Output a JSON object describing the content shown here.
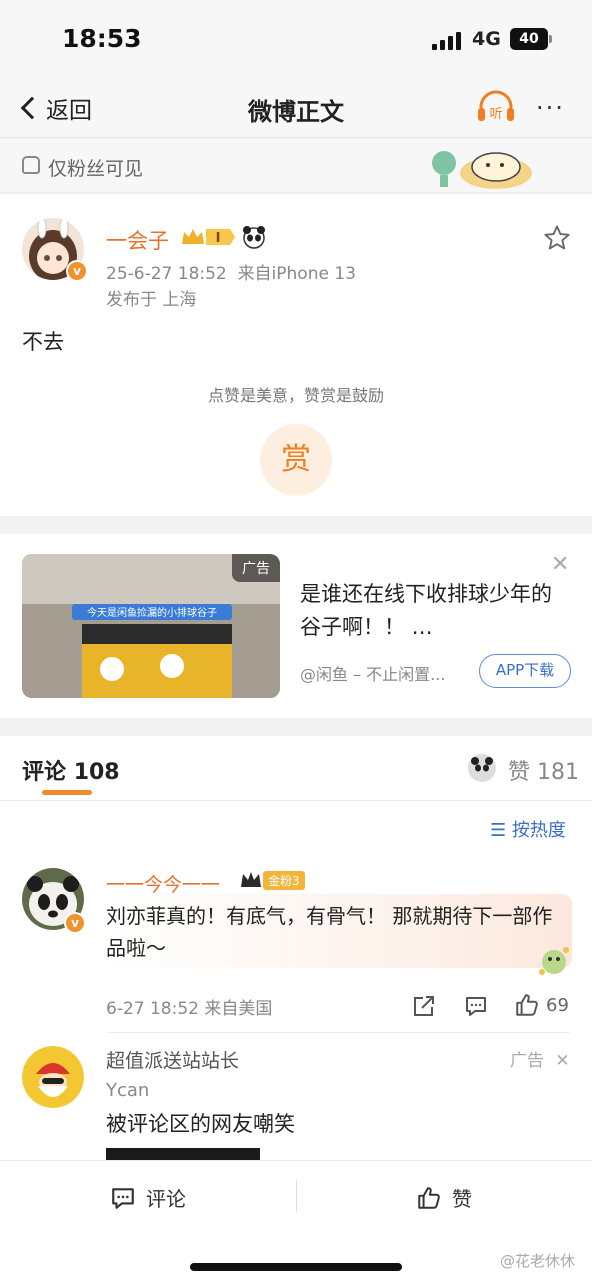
{
  "status_bar": {
    "time": "18:53",
    "network": "4G",
    "battery": "40"
  },
  "nav": {
    "back_label": "返回",
    "title": "微博正文",
    "listen_label": "听",
    "more_label": "···"
  },
  "visibility": {
    "label": "仅粉丝可见"
  },
  "post": {
    "author": "一会子",
    "level": "I",
    "timestamp": "25-6-27 18:52",
    "source": "来自iPhone 13",
    "location": "发布于 上海",
    "content": "不去",
    "reward_hint": "点赞是美意，赞赏是鼓励",
    "reward_button": "赏"
  },
  "ad_card": {
    "tag": "广告",
    "title": "是谁还在线下收排球少年的谷子啊！！ …",
    "source": "@闲鱼 – 不止闲置...",
    "button": "APP下载",
    "image_caption": "今天是闲鱼捡漏的小排球谷子"
  },
  "comments": {
    "tab_label": "评论",
    "count": "108",
    "likes_label": "赞",
    "likes_count": "181",
    "sort_label": "按热度",
    "items": [
      {
        "name": "一一今今一一",
        "fan_badge": "金粉3",
        "text": "刘亦菲真的！有底气，有骨气！ 那就期待下一部作品啦～",
        "meta": "6-27 18:52 来自美国",
        "like_count": "69"
      }
    ],
    "ad": {
      "name": "超值派送站站长",
      "tag": "广告",
      "sub": "Ycan",
      "text": "被评论区的网友嘲笑"
    }
  },
  "bottom_bar": {
    "comment_label": "评论",
    "like_label": "赞"
  },
  "watermark": "@花老休休",
  "colors": {
    "accent": "#e8722a",
    "link": "#3a6fc4"
  }
}
